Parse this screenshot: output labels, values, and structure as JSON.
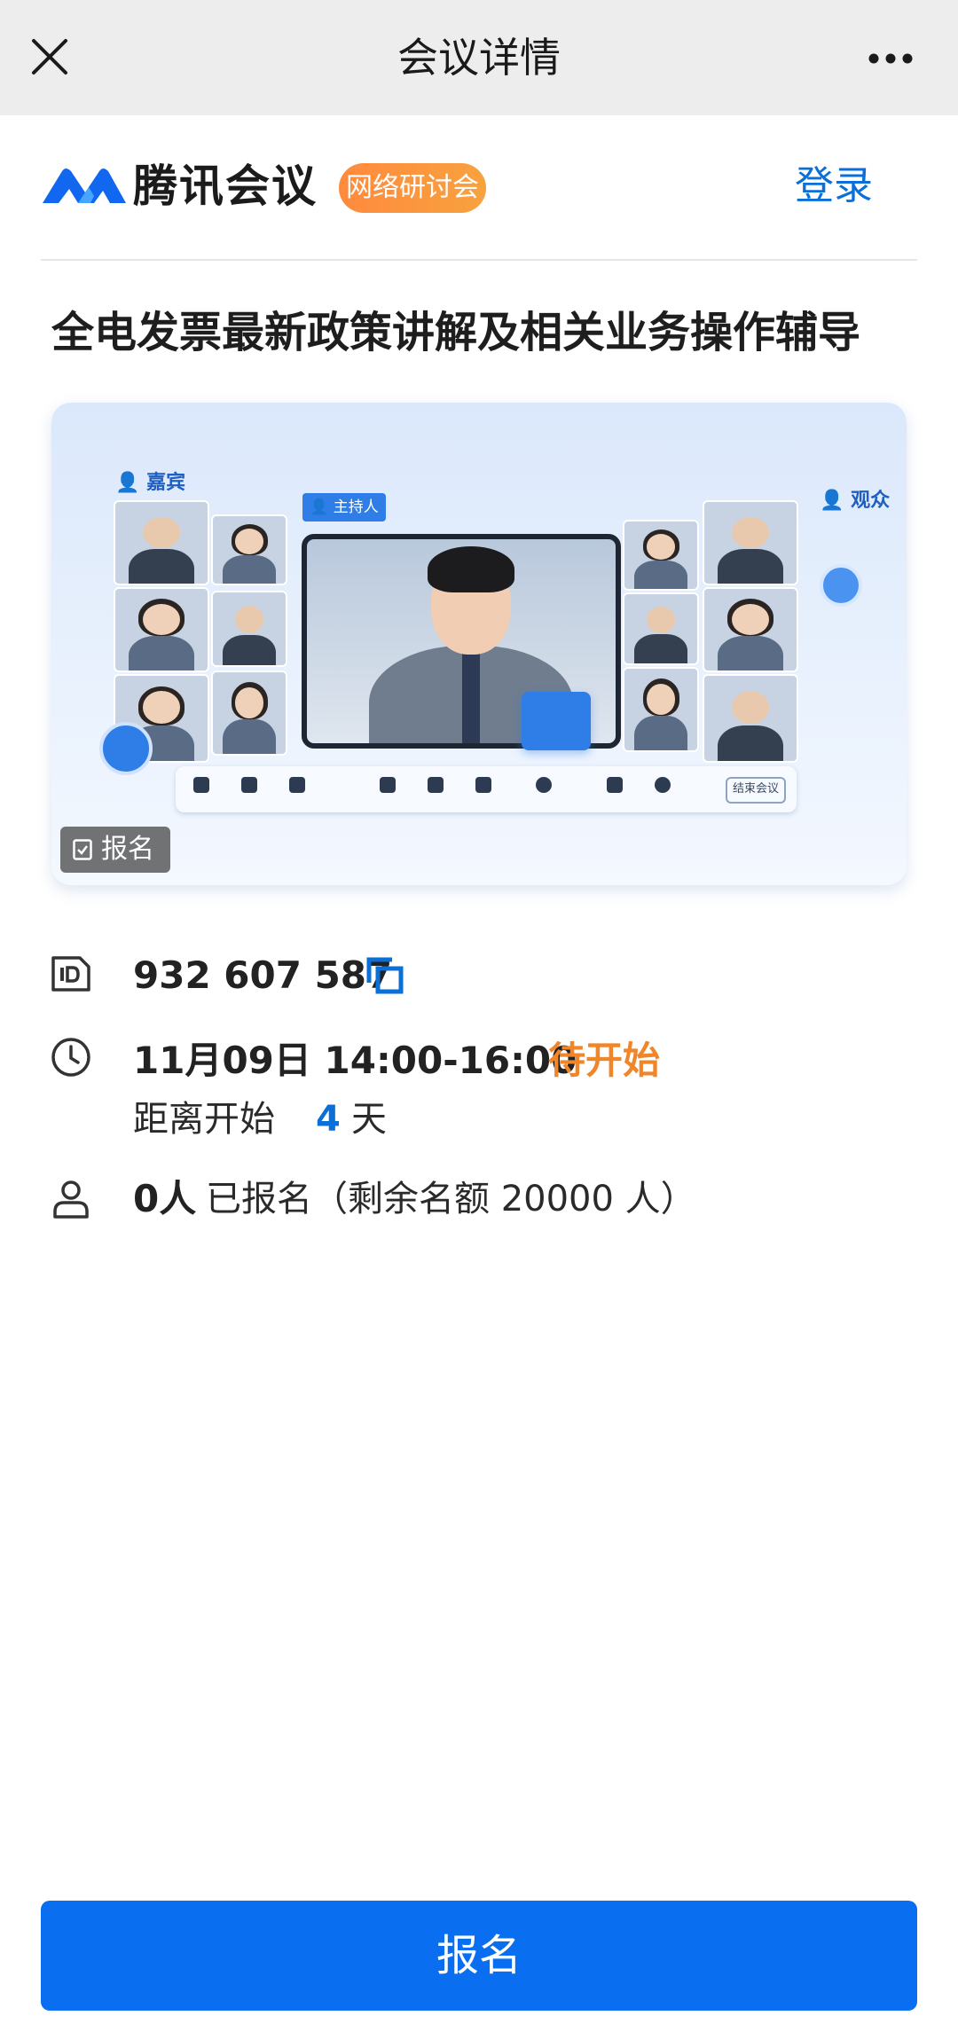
{
  "nav": {
    "title": "会议详情"
  },
  "brand": {
    "name": "腾讯会议",
    "tag": "网络研讨会",
    "login_label": "登录"
  },
  "meeting": {
    "title": "全电发票最新政策讲解及相关业务操作辅导",
    "id": "932 607 587",
    "time": "11月09日 14:00-16:00",
    "status": "待开始",
    "countdown_prefix": "距离开始",
    "countdown_days": "4",
    "countdown_unit": "天",
    "registered_count": "0人",
    "registered_text": "已报名（剩余名额 20000 人）"
  },
  "banner": {
    "host_label": "主持人",
    "guest_label": "嘉宾",
    "audience_label": "观众",
    "end_meeting_label": "结束会议",
    "signup_chip_label": "报名"
  },
  "actions": {
    "signup_label": "报名"
  },
  "colors": {
    "accent": "#0a6ef0",
    "status": "#f0862a",
    "tag_gradient_start": "#ff8a3d",
    "tag_gradient_end": "#f8a23f"
  },
  "icons": [
    "close-icon",
    "more-icon",
    "tencent-meeting-logo",
    "meeting-id-icon",
    "copy-icon",
    "clock-icon",
    "person-icon",
    "signup-form-icon"
  ]
}
